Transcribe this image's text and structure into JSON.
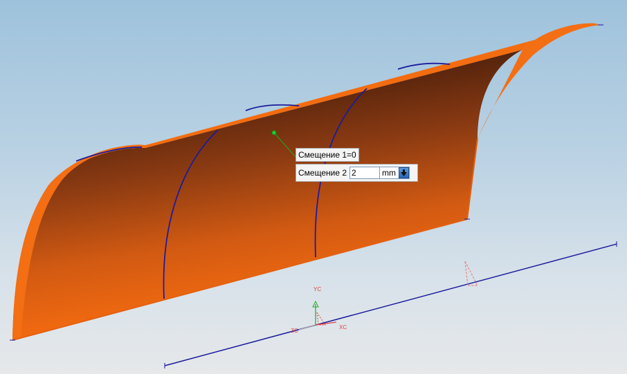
{
  "dialog": {
    "offset1_text": "Смещение 1=0",
    "offset2_label": "Смещение 2",
    "offset2_value": "2",
    "unit": "mm"
  },
  "triad": {
    "yc_label": "YC",
    "xc_label": "XC",
    "zc_label": "ZC"
  },
  "colors": {
    "surface_light": "#f36c10",
    "surface_dark": "#5a2610",
    "curve_blue": "#1c1c9c",
    "handle_green": "#22cc33",
    "axis_red": "#e04040",
    "axis_green": "#22aa22"
  },
  "icons": {
    "dropdown": "down-arrow-icon",
    "handle": "green-drag-handle-icon"
  }
}
